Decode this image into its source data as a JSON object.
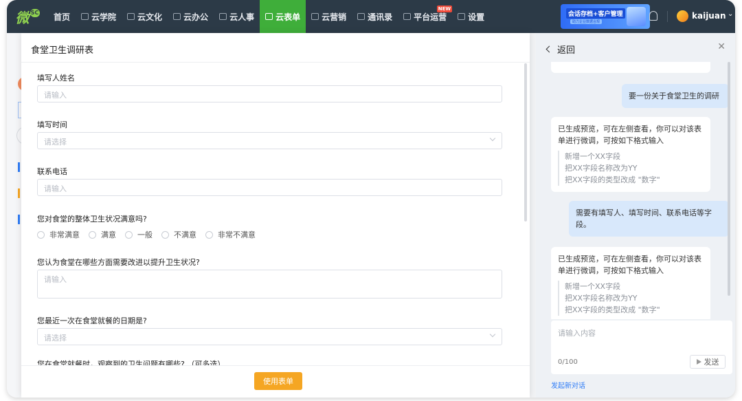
{
  "nav": {
    "logo_text": "微",
    "logo_badge": "SC",
    "items": [
      {
        "label": "首页",
        "icon": "none"
      },
      {
        "label": "云学院",
        "icon": "school-icon"
      },
      {
        "label": "云文化",
        "icon": "culture-icon"
      },
      {
        "label": "云办公",
        "icon": "office-icon"
      },
      {
        "label": "云人事",
        "icon": "hr-icon"
      },
      {
        "label": "云表单",
        "icon": "form-icon",
        "active": true
      },
      {
        "label": "云营销",
        "icon": "marketing-icon"
      },
      {
        "label": "通讯录",
        "icon": "contacts-icon"
      },
      {
        "label": "平台运营",
        "icon": "platform-icon",
        "badge": "NEW"
      },
      {
        "label": "设置",
        "icon": "settings-icon"
      }
    ],
    "banner_title": "会话存档+客户管理",
    "banner_sub": "助力企业数据合规",
    "username": "kaijuan",
    "active_color": "#3fae3a"
  },
  "modal": {
    "title": "食堂卫生调研表",
    "fields": {
      "name_label": "填写人姓名",
      "name_placeholder": "请输入",
      "time_label": "填写时间",
      "time_placeholder": "请选择",
      "phone_label": "联系电话",
      "phone_placeholder": "请输入",
      "satisfaction_label": "您对食堂的整体卫生状况满意吗?",
      "satisfaction_options": [
        "非常满意",
        "满意",
        "一般",
        "不满意",
        "非常不满意"
      ],
      "improve_label": "您认为食堂在哪些方面需要改进以提升卫生状况?",
      "improve_placeholder": "请输入",
      "date_label": "您最近一次在食堂就餐的日期是?",
      "date_placeholder": "请选择",
      "issues_label": "您在食堂就餐时，观察到的卫生问题有哪些? （可多选）"
    },
    "use_button": "使用表单",
    "button_color": "#f5a623"
  },
  "chat": {
    "back_label": "返回",
    "user_msg_1": "要一份关于食堂卫生的调研",
    "bot_msg_1": "已生成预览，可在左侧查看，你可以对该表单进行微调，可按如下格式输入",
    "bot_hints_1": [
      "新增一个XX字段",
      "把XX字段名称改为YY",
      "把XX字段的类型改成 \"数字\""
    ],
    "user_msg_2": "需要有填写人、填写时间、联系电话等字段。",
    "bot_msg_2": "已生成预览，可在左侧查看，你可以对该表单进行微调，可按如下格式输入",
    "bot_hints_2": [
      "新增一个XX字段",
      "把XX字段名称改为YY",
      "把XX字段的类型改成 \"数字\""
    ],
    "input_placeholder": "请输入内容",
    "char_count": "0/100",
    "send_label": "发送",
    "new_chat_label": "发起新对话",
    "link_color": "#2f7cf6"
  }
}
